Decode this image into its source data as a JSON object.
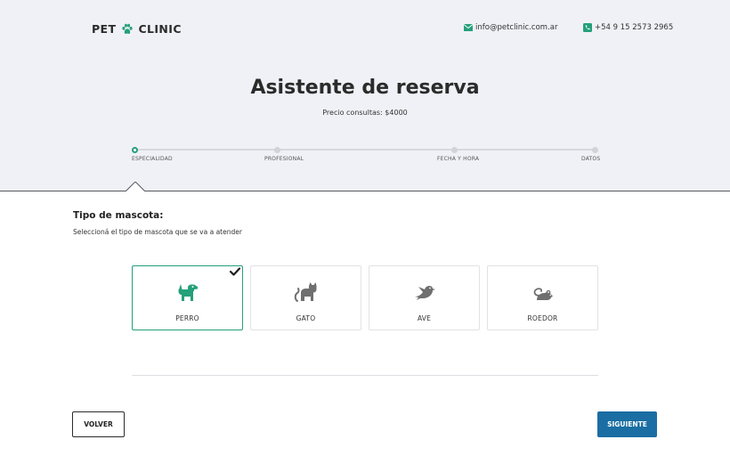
{
  "header": {
    "logo_left": "PET",
    "logo_right": "CLINIC",
    "email": "info@petclinic.com.ar",
    "phone": "+54 9 15 2573 2965"
  },
  "hero": {
    "title": "Asistente de reserva",
    "subtitle": "Precio consultas: $4000"
  },
  "stepper": {
    "steps": [
      {
        "label": "ESPECIALIDAD",
        "active": true
      },
      {
        "label": "PROFESIONAL",
        "active": false
      },
      {
        "label": "FECHA Y HORA",
        "active": false
      },
      {
        "label": "DATOS",
        "active": false
      }
    ]
  },
  "form": {
    "title": "Tipo de mascota:",
    "description": "Seleccioná el tipo de mascota que se va a atender",
    "options": [
      {
        "label": "PERRO",
        "icon": "dog-icon",
        "selected": true
      },
      {
        "label": "GATO",
        "icon": "cat-icon",
        "selected": false
      },
      {
        "label": "AVE",
        "icon": "bird-icon",
        "selected": false
      },
      {
        "label": "ROEDOR",
        "icon": "rodent-icon",
        "selected": false
      }
    ]
  },
  "actions": {
    "back_label": "VOLVER",
    "next_label": "SIGUIENTE"
  },
  "colors": {
    "accent": "#24a07a",
    "primary_button": "#1a6ea3",
    "hero_bg": "#f0f1f6",
    "icon_gray": "#6f6f6f"
  }
}
